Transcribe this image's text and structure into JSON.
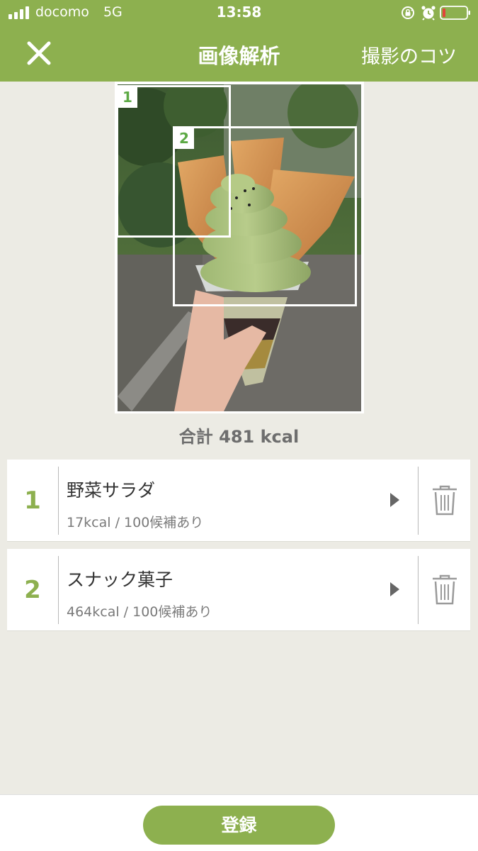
{
  "status_bar": {
    "carrier": "docomo",
    "network": "5G",
    "time": "13:58"
  },
  "header": {
    "title": "画像解析",
    "tips_link": "撮影のコツ",
    "bg_color": "#8db04f"
  },
  "image": {
    "description_icon": "photo-of-matcha-soft-serve",
    "detections": [
      {
        "label": "1"
      },
      {
        "label": "2"
      }
    ]
  },
  "total": {
    "label": "合計 481 kcal"
  },
  "foods": [
    {
      "index": "1",
      "name": "野菜サラダ",
      "detail": "17kcal / 100候補あり"
    },
    {
      "index": "2",
      "name": "スナック菓子",
      "detail": "464kcal / 100候補あり"
    }
  ],
  "footer": {
    "register_label": "登録"
  },
  "colors": {
    "accent": "#8db04f",
    "tag_text": "#5ca944",
    "background": "#ecebe4"
  }
}
